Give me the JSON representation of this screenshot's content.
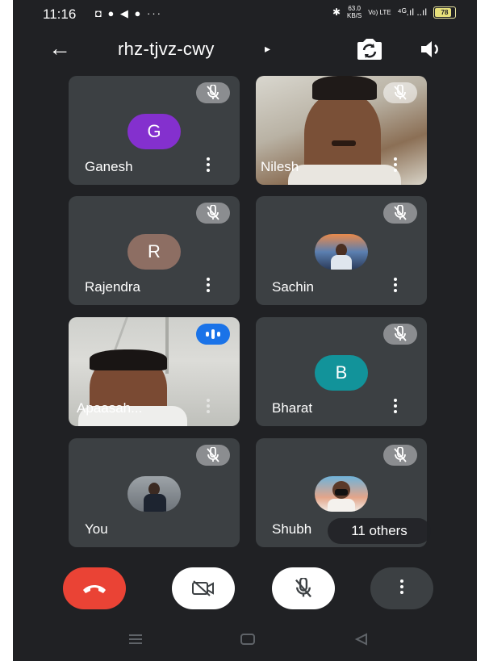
{
  "status_bar": {
    "time": "11:16",
    "notif_icons": "◘ ● ◀ ● ···",
    "bluetooth": "✱",
    "speed_value": "63.0",
    "speed_unit": "KB/S",
    "volte": "Vo) LTE",
    "signal": "⁴ᴳ.ıl ..ıl",
    "battery": "78"
  },
  "header": {
    "meeting_code": "rhz-tjvz-cwy",
    "back_icon": "←",
    "expand_icon": "▸"
  },
  "participants": [
    {
      "name": "Ganesh",
      "initial": "G",
      "avatar_color": "#8430ce",
      "muted": true
    },
    {
      "name": "Nilesh",
      "initial": "",
      "video": true,
      "muted": true
    },
    {
      "name": "Rajendra",
      "initial": "R",
      "avatar_color": "#8d6e63",
      "muted": true
    },
    {
      "name": "Sachin",
      "initial": "",
      "photo": true,
      "muted": true
    },
    {
      "name": "Apaasah...",
      "initial": "",
      "video": true,
      "speaking": true
    },
    {
      "name": "Bharat",
      "initial": "B",
      "avatar_color": "#12939a",
      "muted": true
    },
    {
      "name": "You",
      "initial": "",
      "photo": true,
      "muted": true
    },
    {
      "name": "Shubh",
      "initial": "",
      "photo": true,
      "muted": true
    }
  ],
  "others_label": "11 others",
  "controls": {
    "end_call_color": "#ea4335",
    "cam_off_bg": "#ffffff",
    "mic_off_bg": "#ffffff",
    "more_bg": "#3c4043"
  },
  "colors": {
    "background": "#202124",
    "tile": "#3c4043"
  }
}
